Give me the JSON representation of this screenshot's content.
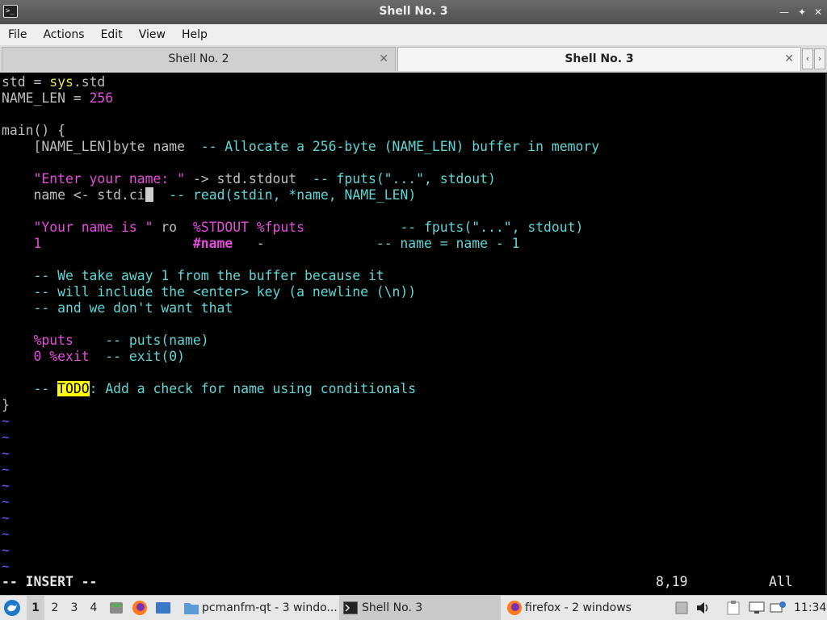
{
  "window": {
    "title": "Shell No. 3"
  },
  "menu": [
    "File",
    "Actions",
    "Edit",
    "View",
    "Help"
  ],
  "tabs": [
    {
      "label": "Shell No. 2",
      "active": false
    },
    {
      "label": "Shell No. 3",
      "active": true
    }
  ],
  "editor": {
    "lines": [
      [
        {
          "t": "std = ",
          "c": "grey"
        },
        {
          "t": "sys",
          "c": "yel"
        },
        {
          "t": ".std",
          "c": "grey"
        }
      ],
      [
        {
          "t": "NAME_LEN = ",
          "c": "grey"
        },
        {
          "t": "256",
          "c": "mag"
        }
      ],
      [],
      [
        {
          "t": "main() {",
          "c": "grey"
        }
      ],
      [
        {
          "t": "    [NAME_LEN]byte name  ",
          "c": "grey"
        },
        {
          "t": "-- Allocate a 256-byte (NAME_LEN) buffer in memory",
          "c": "cyan"
        }
      ],
      [],
      [
        {
          "t": "    ",
          "c": "grey"
        },
        {
          "t": "\"Enter your name: \"",
          "c": "mag"
        },
        {
          "t": " -> std.stdout  ",
          "c": "grey"
        },
        {
          "t": "-- fputs(\"...\", stdout)",
          "c": "cyan"
        }
      ],
      [
        {
          "t": "    name <- std.ci",
          "c": "grey"
        },
        {
          "t": "",
          "c": "cursor"
        },
        {
          "t": "  ",
          "c": "grey"
        },
        {
          "t": "-- read(stdin, *name, NAME_LEN)",
          "c": "cyan"
        }
      ],
      [],
      [
        {
          "t": "    ",
          "c": "grey"
        },
        {
          "t": "\"Your name is \"",
          "c": "mag"
        },
        {
          "t": " ro  ",
          "c": "grey"
        },
        {
          "t": "%STDOUT %fputs",
          "c": "mag"
        },
        {
          "t": "            ",
          "c": "grey"
        },
        {
          "t": "-- fputs(\"...\", stdout)",
          "c": "cyan"
        }
      ],
      [
        {
          "t": "    ",
          "c": "grey"
        },
        {
          "t": "1",
          "c": "mag"
        },
        {
          "t": "                   ",
          "c": "grey"
        },
        {
          "t": "#name",
          "c": "mag bold"
        },
        {
          "t": "   -              ",
          "c": "grey"
        },
        {
          "t": "-- name = name - 1",
          "c": "cyan"
        }
      ],
      [],
      [
        {
          "t": "    ",
          "c": "grey"
        },
        {
          "t": "-- We take away 1 from the buffer because it",
          "c": "cyan"
        }
      ],
      [
        {
          "t": "    ",
          "c": "grey"
        },
        {
          "t": "-- will include the <enter> key (a newline (\\n))",
          "c": "cyan"
        }
      ],
      [
        {
          "t": "    ",
          "c": "grey"
        },
        {
          "t": "-- and we don't want that",
          "c": "cyan"
        }
      ],
      [],
      [
        {
          "t": "    ",
          "c": "grey"
        },
        {
          "t": "%puts",
          "c": "mag"
        },
        {
          "t": "    ",
          "c": "grey"
        },
        {
          "t": "-- puts(name)",
          "c": "cyan"
        }
      ],
      [
        {
          "t": "    ",
          "c": "grey"
        },
        {
          "t": "0 %exit",
          "c": "mag"
        },
        {
          "t": "  ",
          "c": "grey"
        },
        {
          "t": "-- exit(0)",
          "c": "cyan"
        }
      ],
      [],
      [
        {
          "t": "    ",
          "c": "grey"
        },
        {
          "t": "-- ",
          "c": "cyan"
        },
        {
          "t": "TODO",
          "c": "todo"
        },
        {
          "t": ": Add a check for name using conditionals",
          "c": "cyan"
        }
      ],
      [
        {
          "t": "}",
          "c": "grey"
        }
      ],
      [
        {
          "t": "~",
          "c": "blue"
        }
      ],
      [
        {
          "t": "~",
          "c": "blue"
        }
      ],
      [
        {
          "t": "~",
          "c": "blue"
        }
      ],
      [
        {
          "t": "~",
          "c": "blue"
        }
      ],
      [
        {
          "t": "~",
          "c": "blue"
        }
      ],
      [
        {
          "t": "~",
          "c": "blue"
        }
      ],
      [
        {
          "t": "~",
          "c": "blue"
        }
      ],
      [
        {
          "t": "~",
          "c": "blue"
        }
      ],
      [
        {
          "t": "~",
          "c": "blue"
        }
      ],
      [
        {
          "t": "~",
          "c": "blue"
        }
      ]
    ],
    "status": {
      "mode": "-- INSERT --",
      "position": "8,19",
      "scroll": "All"
    }
  },
  "taskbar": {
    "desktops": [
      "1",
      "2",
      "3",
      "4"
    ],
    "current_desktop": "1",
    "tasks": [
      {
        "label": "pcmanfm-qt - 3 windo...",
        "icon": "folder-icon"
      },
      {
        "label": "Shell No. 3",
        "icon": "terminal-icon"
      },
      {
        "label": "firefox - 2 windows",
        "icon": "firefox-icon"
      }
    ],
    "clock": "11:34"
  },
  "colors": {
    "comment": "#5fd7d7",
    "literal": "#e64ddb",
    "builtin": "#e6e657",
    "todo_bg": "#ffff00",
    "tilde": "#5c5cff"
  }
}
